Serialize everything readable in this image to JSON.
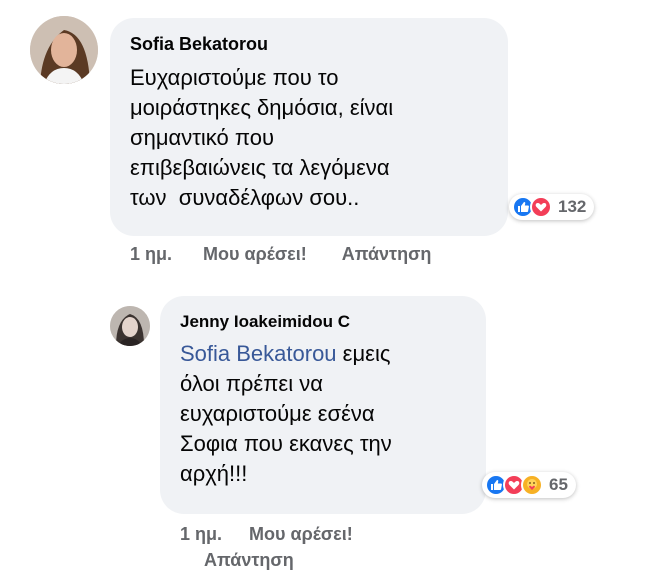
{
  "comments": [
    {
      "author": "Sofia Bekatorou",
      "text_lines": [
        "Ευχαριστούμε που το",
        "μοιράστηκες δημόσια, είναι",
        "σημαντικό που",
        "επιβεβαιώνεις τα λεγόμενα",
        "των  συναδέλφων σου.."
      ],
      "reactions": {
        "icons": [
          "like-icon",
          "love-icon"
        ],
        "count": "132"
      },
      "time": "1 ημ.",
      "like_label": "Μου αρέσει!",
      "reply_label": "Απάντηση"
    },
    {
      "author": "Jenny Ioakeimidou C",
      "mention": "Sofia Bekatorou",
      "text_first_rest": " εμεις",
      "text_lines": [
        "όλοι πρέπει να",
        "ευχαριστούμε εσένα",
        "Σοφια που εκανες την",
        "αρχή!!!"
      ],
      "reactions": {
        "icons": [
          "like-icon",
          "love-icon",
          "care-icon"
        ],
        "count": "65"
      },
      "time": "1 ημ.",
      "like_label": "Μου αρέσει!",
      "reply_label": "Απάντηση"
    }
  ],
  "colors": {
    "bubble": "#f0f2f5",
    "mention": "#385898",
    "like": "#1877f2",
    "love": "#f33e58",
    "care": "#f7b125",
    "meta": "#65676b"
  }
}
